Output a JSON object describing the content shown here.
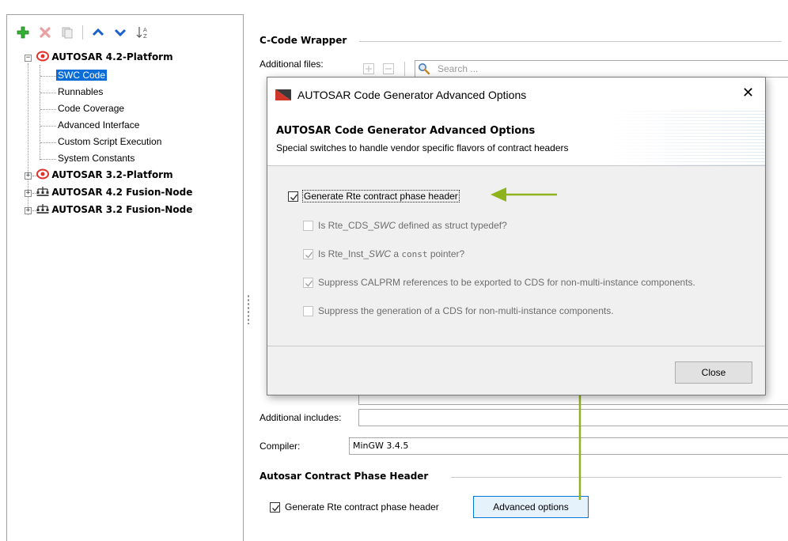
{
  "left_panel": {
    "toolbar": [
      {
        "name": "add-icon",
        "color": "#2eaa2e"
      },
      {
        "name": "delete-icon",
        "color": "#e05050"
      },
      {
        "name": "copy-icon",
        "color": "#9a9a9a"
      },
      {
        "name": "move-up-icon",
        "color": "#1a62c9"
      },
      {
        "name": "move-down-icon",
        "color": "#1a62c9"
      },
      {
        "name": "sort-az-icon",
        "color": "#555555"
      }
    ],
    "tree": {
      "root1_label": "AUTOSAR 4.2-Platform",
      "children": [
        "SWC Code",
        "Runnables",
        "Code Coverage",
        "Advanced Interface",
        "Custom Script Execution",
        "System Constants"
      ],
      "root2_label": "AUTOSAR 3.2-Platform",
      "root3_label": "AUTOSAR 4.2 Fusion-Node",
      "root4_label": "AUTOSAR 3.2 Fusion-Node",
      "selected": "SWC Code"
    }
  },
  "right_panel": {
    "section1_title": "C-Code Wrapper",
    "additional_files_label": "Additional files:",
    "search_placeholder": "Search ...",
    "additional_includes_label": "Additional includes:",
    "additional_includes_value": "",
    "compiler_label": "Compiler:",
    "compiler_value": "MinGW 3.4.5",
    "section2_title": "Autosar Contract Phase Header",
    "generate_header_label": "Generate Rte contract phase header",
    "generate_header_checked": true,
    "advanced_button_label": "Advanced options"
  },
  "dialog": {
    "title": "AUTOSAR Code Generator Advanced Options",
    "header_title": "AUTOSAR Code Generator Advanced Options",
    "header_subtitle": "Special switches to handle vendor specific flavors of contract headers",
    "option_main": {
      "label": "Generate Rte contract phase header",
      "checked": true
    },
    "option_cds_typedef": {
      "prefix": "Is Rte_CDS_",
      "italic": "SWC",
      "suffix": " defined as struct typedef?",
      "checked": false,
      "enabled": false
    },
    "option_inst_const": {
      "prefix": "Is Rte_Inst_",
      "italic": "SWC",
      "middle": " a ",
      "code": "const",
      "suffix": " pointer?",
      "checked": true,
      "enabled": false
    },
    "option_suppress_calprm": {
      "label": "Suppress CALPRM references to be exported to CDS for non-multi-instance components.",
      "checked": true,
      "enabled": false
    },
    "option_suppress_cds": {
      "label": "Suppress the generation of a CDS for non-multi-instance components.",
      "checked": false,
      "enabled": false
    },
    "close_label": "Close",
    "close_glyph": "✕"
  },
  "annotations": {
    "arrow_color": "#8fb31d"
  }
}
